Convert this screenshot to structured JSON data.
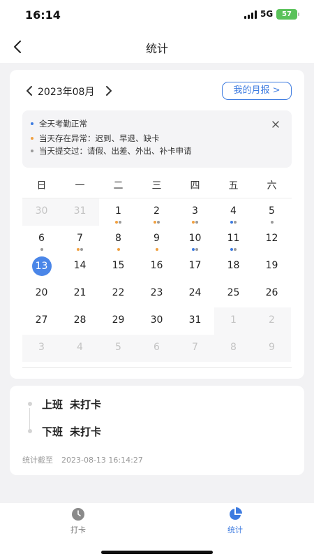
{
  "status_bar": {
    "time": "16:14",
    "network": "5G",
    "battery": "57"
  },
  "nav": {
    "title": "统计",
    "back_icon": "chevron-left-icon"
  },
  "calendar": {
    "month_label": "2023年08月",
    "report_button": "我的月报 >",
    "legend": [
      {
        "color": "#3d7be0",
        "text": "全天考勤正常"
      },
      {
        "color": "#f0a040",
        "text": "当天存在异常：迟到、早退、缺卡"
      },
      {
        "color": "#9a9a9a",
        "text": "当天提交过：请假、出差、外出、补卡申请"
      }
    ],
    "weekdays": [
      "日",
      "一",
      "二",
      "三",
      "四",
      "五",
      "六"
    ],
    "days": [
      {
        "d": "30",
        "other": true,
        "dots": []
      },
      {
        "d": "31",
        "other": true,
        "dots": []
      },
      {
        "d": "1",
        "dots": [
          "#f0a040",
          "#9a9a9a"
        ]
      },
      {
        "d": "2",
        "dots": [
          "#f0a040",
          "#9a9a9a"
        ]
      },
      {
        "d": "3",
        "dots": [
          "#f0a040",
          "#9a9a9a"
        ]
      },
      {
        "d": "4",
        "dots": [
          "#3d7be0",
          "#9a9a9a"
        ]
      },
      {
        "d": "5",
        "dots": [
          "#9a9a9a"
        ]
      },
      {
        "d": "6",
        "dots": [
          "#9a9a9a"
        ]
      },
      {
        "d": "7",
        "dots": [
          "#f0a040",
          "#9a9a9a"
        ]
      },
      {
        "d": "8",
        "dots": [
          "#f0a040"
        ]
      },
      {
        "d": "9",
        "dots": [
          "#f0a040"
        ]
      },
      {
        "d": "10",
        "dots": [
          "#3d7be0",
          "#9a9a9a"
        ]
      },
      {
        "d": "11",
        "dots": [
          "#3d7be0",
          "#9a9a9a"
        ]
      },
      {
        "d": "12",
        "dots": []
      },
      {
        "d": "13",
        "today": true,
        "dots": []
      },
      {
        "d": "14",
        "dots": []
      },
      {
        "d": "15",
        "dots": []
      },
      {
        "d": "16",
        "dots": []
      },
      {
        "d": "17",
        "dots": []
      },
      {
        "d": "18",
        "dots": []
      },
      {
        "d": "19",
        "dots": []
      },
      {
        "d": "20",
        "dots": []
      },
      {
        "d": "21",
        "dots": []
      },
      {
        "d": "22",
        "dots": []
      },
      {
        "d": "23",
        "dots": []
      },
      {
        "d": "24",
        "dots": []
      },
      {
        "d": "25",
        "dots": []
      },
      {
        "d": "26",
        "dots": []
      },
      {
        "d": "27",
        "dots": []
      },
      {
        "d": "28",
        "dots": []
      },
      {
        "d": "29",
        "dots": []
      },
      {
        "d": "30",
        "dots": []
      },
      {
        "d": "31",
        "dots": []
      },
      {
        "d": "1",
        "other": true,
        "dots": []
      },
      {
        "d": "2",
        "other": true,
        "dots": []
      },
      {
        "d": "3",
        "other": true,
        "dots": []
      },
      {
        "d": "4",
        "other": true,
        "dots": []
      },
      {
        "d": "5",
        "other": true,
        "dots": []
      },
      {
        "d": "6",
        "other": true,
        "dots": []
      },
      {
        "d": "7",
        "other": true,
        "dots": []
      },
      {
        "d": "8",
        "other": true,
        "dots": []
      },
      {
        "d": "9",
        "other": true,
        "dots": []
      }
    ]
  },
  "punch": {
    "rows": [
      {
        "label": "上班",
        "status": "未打卡"
      },
      {
        "label": "下班",
        "status": "未打卡"
      }
    ],
    "stat_label": "统计截至",
    "stat_time": "2023-08-13 16:14:27"
  },
  "tabs": [
    {
      "label": "打卡",
      "icon": "clock-icon",
      "active": false
    },
    {
      "label": "统计",
      "icon": "pie-chart-icon",
      "active": true
    }
  ],
  "colors": {
    "accent": "#3d7be0",
    "today": "#4a86e8",
    "tab_active": "#3d7be0",
    "tab_inactive": "#777777"
  }
}
